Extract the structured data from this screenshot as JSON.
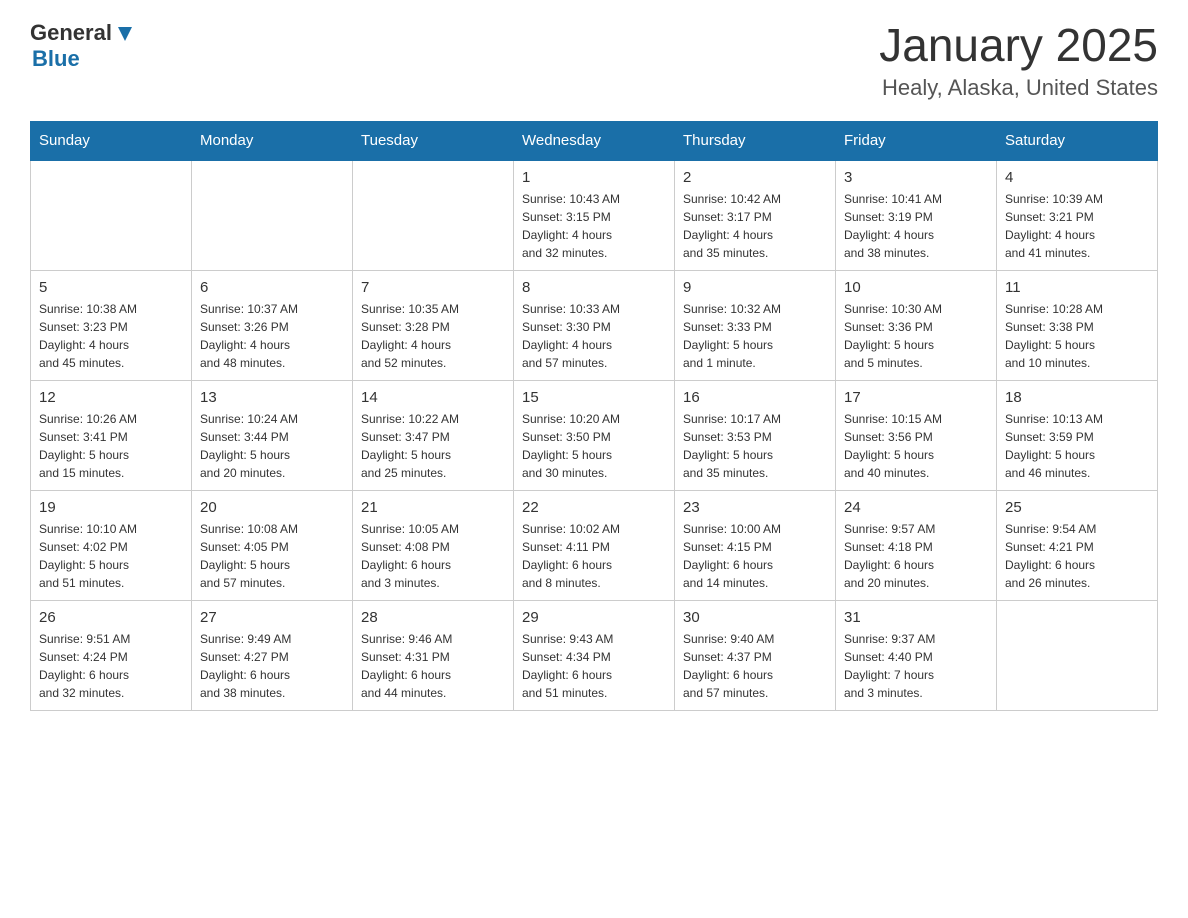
{
  "header": {
    "logo_general": "General",
    "logo_blue": "Blue",
    "title": "January 2025",
    "subtitle": "Healy, Alaska, United States"
  },
  "days_of_week": [
    "Sunday",
    "Monday",
    "Tuesday",
    "Wednesday",
    "Thursday",
    "Friday",
    "Saturday"
  ],
  "weeks": [
    [
      {
        "day": "",
        "info": ""
      },
      {
        "day": "",
        "info": ""
      },
      {
        "day": "",
        "info": ""
      },
      {
        "day": "1",
        "info": "Sunrise: 10:43 AM\nSunset: 3:15 PM\nDaylight: 4 hours\nand 32 minutes."
      },
      {
        "day": "2",
        "info": "Sunrise: 10:42 AM\nSunset: 3:17 PM\nDaylight: 4 hours\nand 35 minutes."
      },
      {
        "day": "3",
        "info": "Sunrise: 10:41 AM\nSunset: 3:19 PM\nDaylight: 4 hours\nand 38 minutes."
      },
      {
        "day": "4",
        "info": "Sunrise: 10:39 AM\nSunset: 3:21 PM\nDaylight: 4 hours\nand 41 minutes."
      }
    ],
    [
      {
        "day": "5",
        "info": "Sunrise: 10:38 AM\nSunset: 3:23 PM\nDaylight: 4 hours\nand 45 minutes."
      },
      {
        "day": "6",
        "info": "Sunrise: 10:37 AM\nSunset: 3:26 PM\nDaylight: 4 hours\nand 48 minutes."
      },
      {
        "day": "7",
        "info": "Sunrise: 10:35 AM\nSunset: 3:28 PM\nDaylight: 4 hours\nand 52 minutes."
      },
      {
        "day": "8",
        "info": "Sunrise: 10:33 AM\nSunset: 3:30 PM\nDaylight: 4 hours\nand 57 minutes."
      },
      {
        "day": "9",
        "info": "Sunrise: 10:32 AM\nSunset: 3:33 PM\nDaylight: 5 hours\nand 1 minute."
      },
      {
        "day": "10",
        "info": "Sunrise: 10:30 AM\nSunset: 3:36 PM\nDaylight: 5 hours\nand 5 minutes."
      },
      {
        "day": "11",
        "info": "Sunrise: 10:28 AM\nSunset: 3:38 PM\nDaylight: 5 hours\nand 10 minutes."
      }
    ],
    [
      {
        "day": "12",
        "info": "Sunrise: 10:26 AM\nSunset: 3:41 PM\nDaylight: 5 hours\nand 15 minutes."
      },
      {
        "day": "13",
        "info": "Sunrise: 10:24 AM\nSunset: 3:44 PM\nDaylight: 5 hours\nand 20 minutes."
      },
      {
        "day": "14",
        "info": "Sunrise: 10:22 AM\nSunset: 3:47 PM\nDaylight: 5 hours\nand 25 minutes."
      },
      {
        "day": "15",
        "info": "Sunrise: 10:20 AM\nSunset: 3:50 PM\nDaylight: 5 hours\nand 30 minutes."
      },
      {
        "day": "16",
        "info": "Sunrise: 10:17 AM\nSunset: 3:53 PM\nDaylight: 5 hours\nand 35 minutes."
      },
      {
        "day": "17",
        "info": "Sunrise: 10:15 AM\nSunset: 3:56 PM\nDaylight: 5 hours\nand 40 minutes."
      },
      {
        "day": "18",
        "info": "Sunrise: 10:13 AM\nSunset: 3:59 PM\nDaylight: 5 hours\nand 46 minutes."
      }
    ],
    [
      {
        "day": "19",
        "info": "Sunrise: 10:10 AM\nSunset: 4:02 PM\nDaylight: 5 hours\nand 51 minutes."
      },
      {
        "day": "20",
        "info": "Sunrise: 10:08 AM\nSunset: 4:05 PM\nDaylight: 5 hours\nand 57 minutes."
      },
      {
        "day": "21",
        "info": "Sunrise: 10:05 AM\nSunset: 4:08 PM\nDaylight: 6 hours\nand 3 minutes."
      },
      {
        "day": "22",
        "info": "Sunrise: 10:02 AM\nSunset: 4:11 PM\nDaylight: 6 hours\nand 8 minutes."
      },
      {
        "day": "23",
        "info": "Sunrise: 10:00 AM\nSunset: 4:15 PM\nDaylight: 6 hours\nand 14 minutes."
      },
      {
        "day": "24",
        "info": "Sunrise: 9:57 AM\nSunset: 4:18 PM\nDaylight: 6 hours\nand 20 minutes."
      },
      {
        "day": "25",
        "info": "Sunrise: 9:54 AM\nSunset: 4:21 PM\nDaylight: 6 hours\nand 26 minutes."
      }
    ],
    [
      {
        "day": "26",
        "info": "Sunrise: 9:51 AM\nSunset: 4:24 PM\nDaylight: 6 hours\nand 32 minutes."
      },
      {
        "day": "27",
        "info": "Sunrise: 9:49 AM\nSunset: 4:27 PM\nDaylight: 6 hours\nand 38 minutes."
      },
      {
        "day": "28",
        "info": "Sunrise: 9:46 AM\nSunset: 4:31 PM\nDaylight: 6 hours\nand 44 minutes."
      },
      {
        "day": "29",
        "info": "Sunrise: 9:43 AM\nSunset: 4:34 PM\nDaylight: 6 hours\nand 51 minutes."
      },
      {
        "day": "30",
        "info": "Sunrise: 9:40 AM\nSunset: 4:37 PM\nDaylight: 6 hours\nand 57 minutes."
      },
      {
        "day": "31",
        "info": "Sunrise: 9:37 AM\nSunset: 4:40 PM\nDaylight: 7 hours\nand 3 minutes."
      },
      {
        "day": "",
        "info": ""
      }
    ]
  ]
}
